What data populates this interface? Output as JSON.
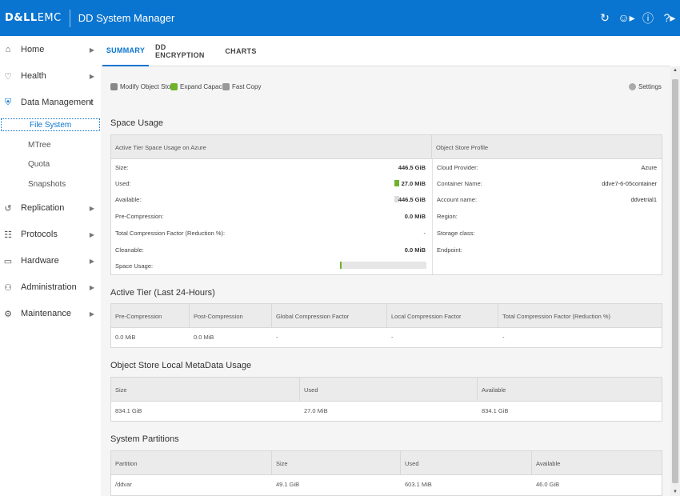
{
  "header": {
    "brand_dell": "D&LL",
    "brand_emc": "EMC",
    "title": "DD System Manager",
    "icons": [
      "refresh-icon",
      "user-icon",
      "info-icon",
      "help-icon"
    ]
  },
  "sidebar": {
    "items": [
      {
        "label": "Home",
        "icon": "home-icon"
      },
      {
        "label": "Health",
        "icon": "heart-icon"
      },
      {
        "label": "Data Management",
        "icon": "shield-icon"
      },
      {
        "label": "Replication",
        "icon": "sync-icon"
      },
      {
        "label": "Protocols",
        "icon": "protocols-icon"
      },
      {
        "label": "Hardware",
        "icon": "hardware-icon"
      },
      {
        "label": "Administration",
        "icon": "admin-icon"
      },
      {
        "label": "Maintenance",
        "icon": "maintenance-icon"
      }
    ],
    "sub_items": [
      "File System",
      "MTree",
      "Quota",
      "Snapshots"
    ]
  },
  "tabs": [
    "SUMMARY",
    "DD ENCRYPTION",
    "CHARTS"
  ],
  "toolbar": {
    "modify": "Modify Object Store",
    "expand": "Expand Capacity",
    "fastcopy": "Fast Copy",
    "settings": "Settings"
  },
  "space_usage": {
    "title": "Space Usage",
    "left_header": "Active Tier Space Usage on Azure",
    "right_header": "Object Store Profile",
    "left_rows": [
      {
        "label": "Size:",
        "value": "446.5 GiB"
      },
      {
        "label": "Used:",
        "value": "27.0 MiB"
      },
      {
        "label": "Available:",
        "value": "446.5 GiB"
      },
      {
        "label": "Pre-Compression:",
        "value": "0.0 MiB"
      },
      {
        "label": "Total Compression Factor (Reduction %):",
        "value": "-"
      },
      {
        "label": "Cleanable:",
        "value": "0.0 MiB"
      },
      {
        "label": "Space Usage:",
        "value": ""
      }
    ],
    "usage_fraction": 0.01,
    "used_color": "#6fb32d",
    "available_color": "#dddddd",
    "right_rows": [
      {
        "label": "Cloud Provider:",
        "value": "Azure"
      },
      {
        "label": "Container Name:",
        "value": "ddve7-6-05container"
      },
      {
        "label": "Account name:",
        "value": "ddvetrial1"
      },
      {
        "label": "Region:",
        "value": ""
      },
      {
        "label": "Storage class:",
        "value": ""
      },
      {
        "label": "Endpoint:",
        "value": ""
      }
    ]
  },
  "active_tier": {
    "title": "Active Tier (Last 24-Hours)",
    "headers": [
      "Pre-Compression",
      "Post-Compression",
      "Global Compression Factor",
      "Local Compression Factor",
      "Total Compression Factor (Reduction %)"
    ],
    "row": [
      "0.0 MiB",
      "0.0 MiB",
      "-",
      "-",
      "-"
    ]
  },
  "metadata": {
    "title": "Object Store Local MetaData Usage",
    "headers": [
      "Size",
      "Used",
      "Available"
    ],
    "row": [
      "834.1 GiB",
      "27.0 MiB",
      "834.1 GiB"
    ]
  },
  "partitions": {
    "title": "System Partitions",
    "headers": [
      "Partition",
      "Size",
      "Used",
      "Available"
    ],
    "row": [
      "/ddvar",
      "49.1 GiB",
      "603.1 MiB",
      "46.0 GiB"
    ]
  }
}
